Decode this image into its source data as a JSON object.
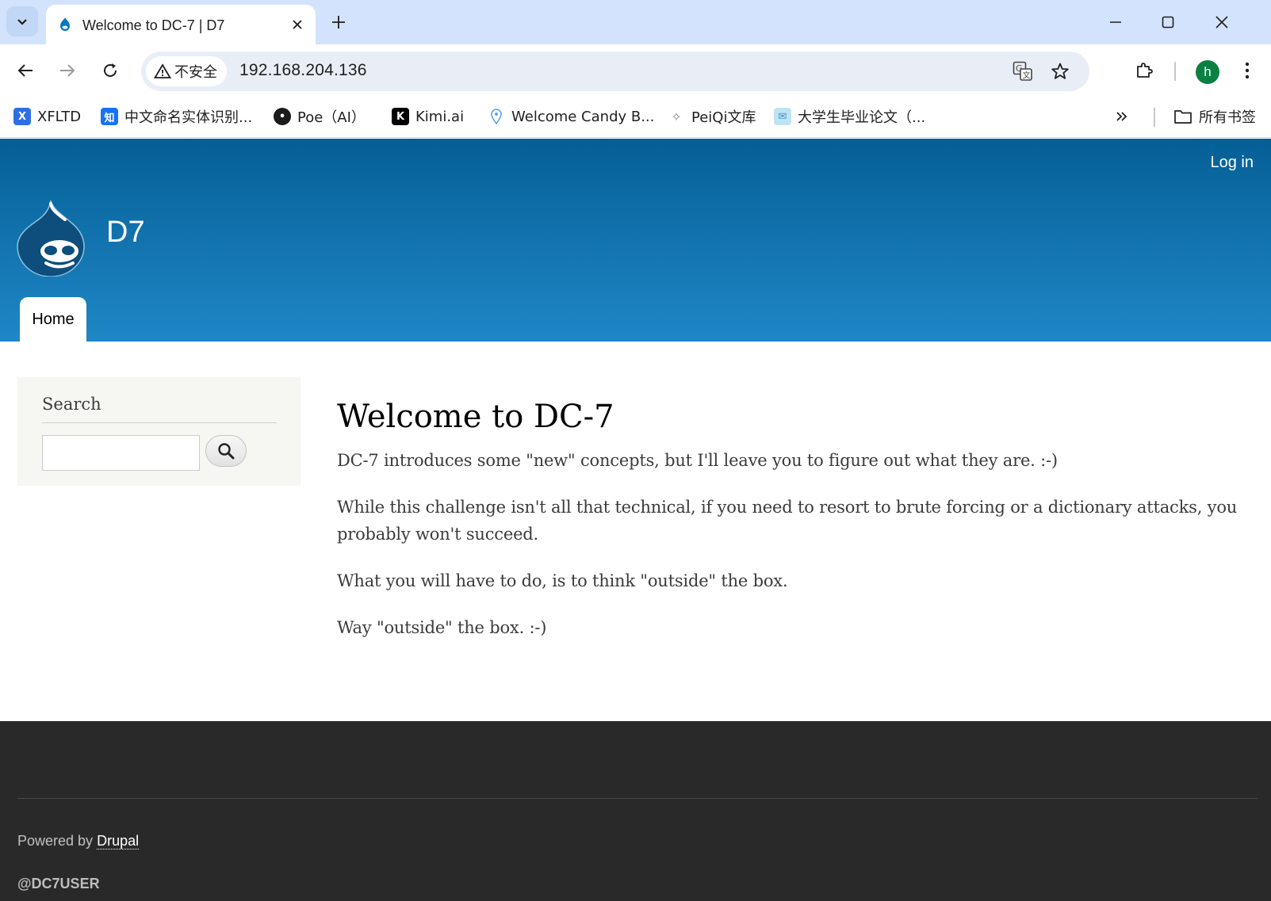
{
  "browser": {
    "tab": {
      "title": "Welcome to DC-7 | D7"
    },
    "omnibox": {
      "security_label": "不安全",
      "url": "192.168.204.136"
    },
    "profile_initial": "h",
    "bookmarks": [
      {
        "label": "XFLTD",
        "icon_glyph": "X",
        "icon_color": "#2f6fe4"
      },
      {
        "label": "中文命名实体识别...",
        "icon_glyph": "知",
        "icon_color": "#1772f6"
      },
      {
        "label": "Poe（AI）",
        "icon_glyph": "P",
        "icon_color": "#1b1b1b"
      },
      {
        "label": "Kimi.ai",
        "icon_glyph": "K",
        "icon_color": "#000000"
      },
      {
        "label": "Welcome Candy B...",
        "icon_glyph": "C",
        "icon_color": "#5aa6e8"
      },
      {
        "label": "PeiQi文库",
        "icon_glyph": "P",
        "icon_color": "#8a8a8a"
      },
      {
        "label": "大学生毕业论文（...",
        "icon_glyph": "大",
        "icon_color": "#5fb0d6"
      }
    ],
    "all_bookmarks_label": "所有书签"
  },
  "site": {
    "login_label": "Log in",
    "name": "D7",
    "nav": {
      "home_label": "Home"
    },
    "colors": {
      "header_top": "#055f96",
      "header_bottom": "#1f87c6",
      "footer": "#292929"
    }
  },
  "sidebar": {
    "search_title": "Search",
    "search_value": ""
  },
  "main": {
    "title": "Welcome to DC-7",
    "paragraphs": [
      "DC-7 introduces some \"new\" concepts, but I'll leave you to figure out what they are.  :-)",
      "While this challenge isn't all that technical, if you need to resort to brute forcing or a dictionary attacks, you probably won't succeed.",
      "What you will have to do, is to think \"outside\" the box.",
      "Way \"outside\" the box.  :-)"
    ]
  },
  "footer": {
    "powered_prefix": "Powered by",
    "powered_link": "Drupal",
    "handle": "@DC7USER"
  }
}
